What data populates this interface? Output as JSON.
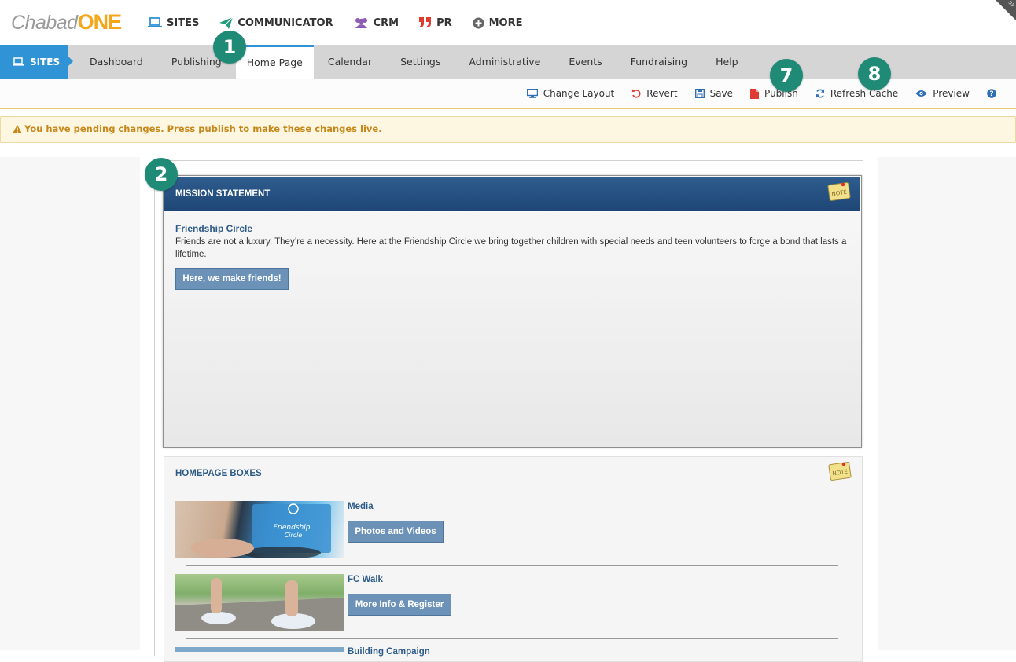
{
  "logo": {
    "part1": "Chabad",
    "part2": "ONE"
  },
  "corner_label": "עב",
  "top_nav": [
    {
      "label": "SITES",
      "icon": "laptop-icon",
      "color": "#2f93d6"
    },
    {
      "label": "COMMUNICATOR",
      "icon": "paper-plane-icon",
      "color": "#1f9b7a"
    },
    {
      "label": "CRM",
      "icon": "users-icon",
      "color": "#8e5bb5"
    },
    {
      "label": "PR",
      "icon": "quote-icon",
      "color": "#e03c31"
    },
    {
      "label": "MORE",
      "icon": "plus-circle-icon",
      "color": "#666666"
    }
  ],
  "section_tab": {
    "label": "SITES",
    "icon": "laptop-icon"
  },
  "tabs": [
    "Dashboard",
    "Publishing",
    "Home Page",
    "Calendar",
    "Settings",
    "Administrative",
    "Events",
    "Fundraising",
    "Help"
  ],
  "active_tab": "Home Page",
  "toolbar": {
    "change_layout": "Change Layout",
    "revert": "Revert",
    "save": "Save",
    "publish": "Publish",
    "refresh_cache": "Refresh Cache",
    "preview": "Preview",
    "help_icon": "question-circle-icon"
  },
  "alert": {
    "text": "You have pending changes. Press publish to make these changes live.",
    "icon": "warning-icon"
  },
  "mission": {
    "header": "MISSION STATEMENT",
    "subtitle": "Friendship Circle",
    "text": "Friends are not a luxury. They’re a necessity. Here at the Friendship Circle we bring together children with special needs and teen volunteers to forge a bond that lasts a lifetime.",
    "button": "Here, we make friends!"
  },
  "homepage_boxes": {
    "title": "HOMEPAGE BOXES",
    "items": [
      {
        "title": "Media",
        "button": "Photos and Videos"
      },
      {
        "title": "FC Walk",
        "button": "More Info & Register"
      },
      {
        "title": "Building Campaign"
      }
    ]
  },
  "callouts": [
    "1",
    "2",
    "7",
    "8"
  ],
  "colors": {
    "accent_blue": "#2f93d6",
    "header_navy": "#1e4676",
    "callout_green": "#1f8a76",
    "alert_text": "#c7871a",
    "button_blue": "#6c92b7"
  }
}
